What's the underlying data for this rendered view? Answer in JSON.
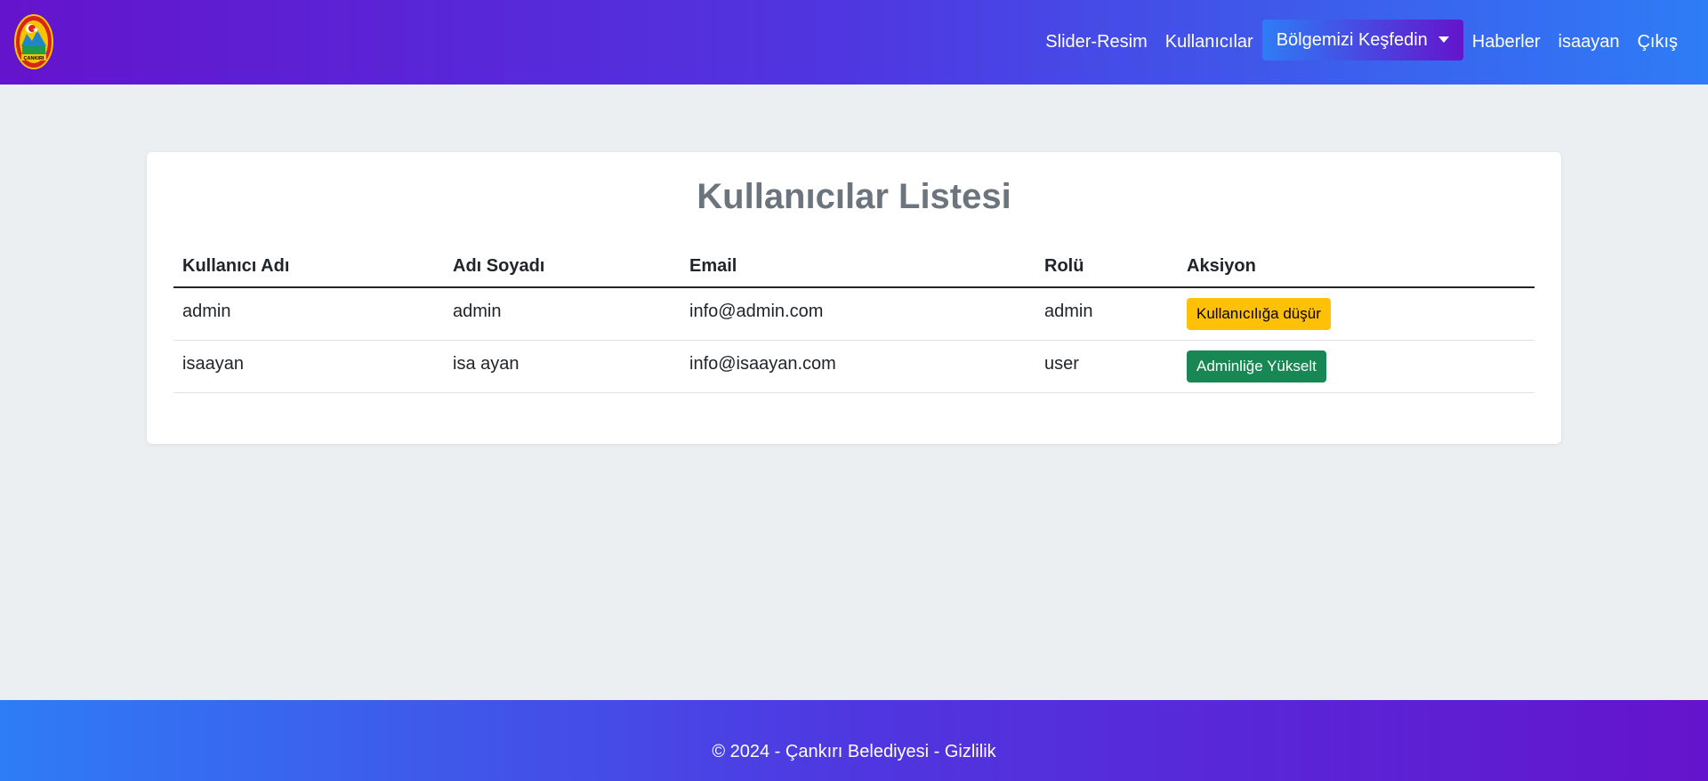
{
  "navbar": {
    "logo_icon": "cankiri-belediyesi-logo",
    "logo_text": "ÇANKIRI",
    "links": {
      "slider": "Slider-Resim",
      "users": "Kullanıcılar",
      "explore": "Bölgemizi Keşfedin",
      "news": "Haberler",
      "profile": "isaayan",
      "logout": "Çıkış"
    },
    "colors": {
      "gradient_start": "#6414cc",
      "gradient_end": "#2e7cf6"
    }
  },
  "main": {
    "title": "Kullanıcılar Listesi",
    "table": {
      "headers": [
        "Kullanıcı Adı",
        "Adı Soyadı",
        "Email",
        "Rolü",
        "Aksiyon"
      ],
      "rows": [
        {
          "username": "admin",
          "fullname": "admin",
          "email": "info@admin.com",
          "role": "admin",
          "action": "Kullanıcılığa düşür",
          "action_color": "#ffc107"
        },
        {
          "username": "isaayan",
          "fullname": "isa ayan",
          "email": "info@isaayan.com",
          "role": "user",
          "action": "Adminliğe Yükselt",
          "action_color": "#198754"
        }
      ]
    }
  },
  "footer": {
    "text": "© 2024 - Çankırı Belediyesi - ",
    "privacy_link": "Gizlilik"
  }
}
